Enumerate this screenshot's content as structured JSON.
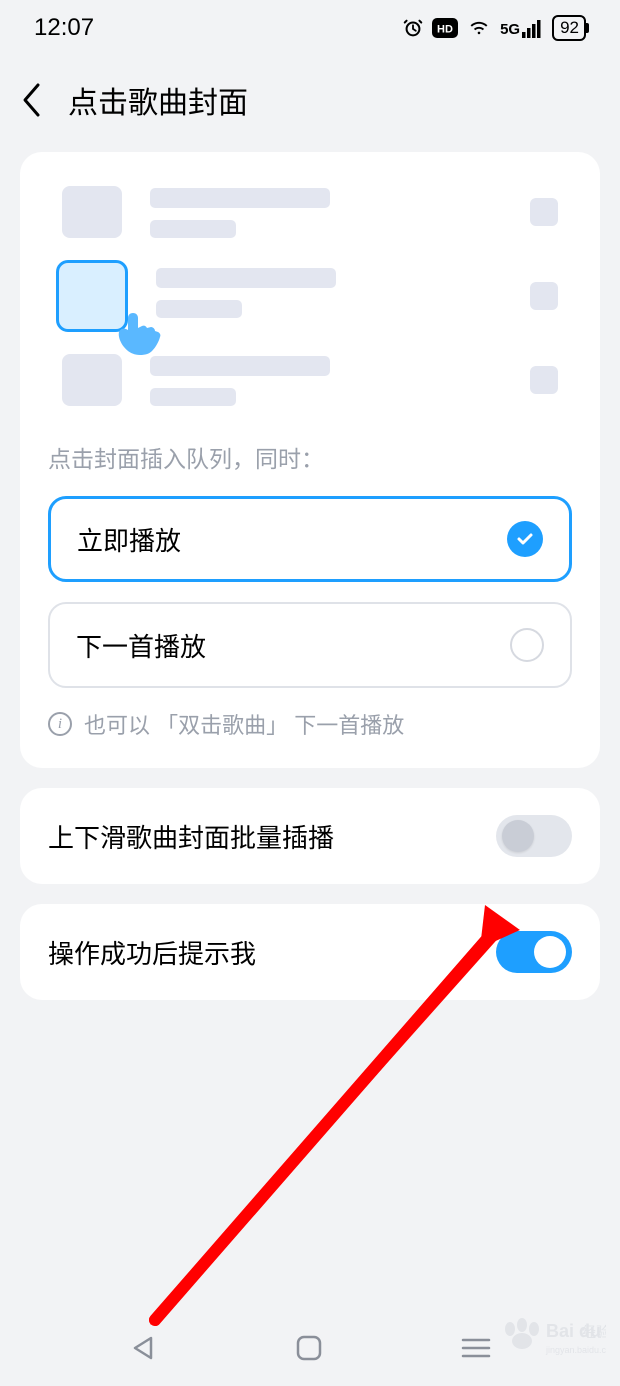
{
  "status": {
    "time": "12:07",
    "network": "5G",
    "battery": "92"
  },
  "header": {
    "title": "点击歌曲封面"
  },
  "main": {
    "section_label": "点击封面插入队列，同时：",
    "options": [
      {
        "label": "立即播放",
        "selected": true
      },
      {
        "label": "下一首播放",
        "selected": false
      }
    ],
    "hint": "也可以 「双击歌曲」 下一首播放"
  },
  "settings": [
    {
      "label": "上下滑歌曲封面批量插播",
      "on": false
    },
    {
      "label": "操作成功后提示我",
      "on": true
    }
  ],
  "watermark": {
    "brand": "Baidu",
    "sub": "经验"
  }
}
